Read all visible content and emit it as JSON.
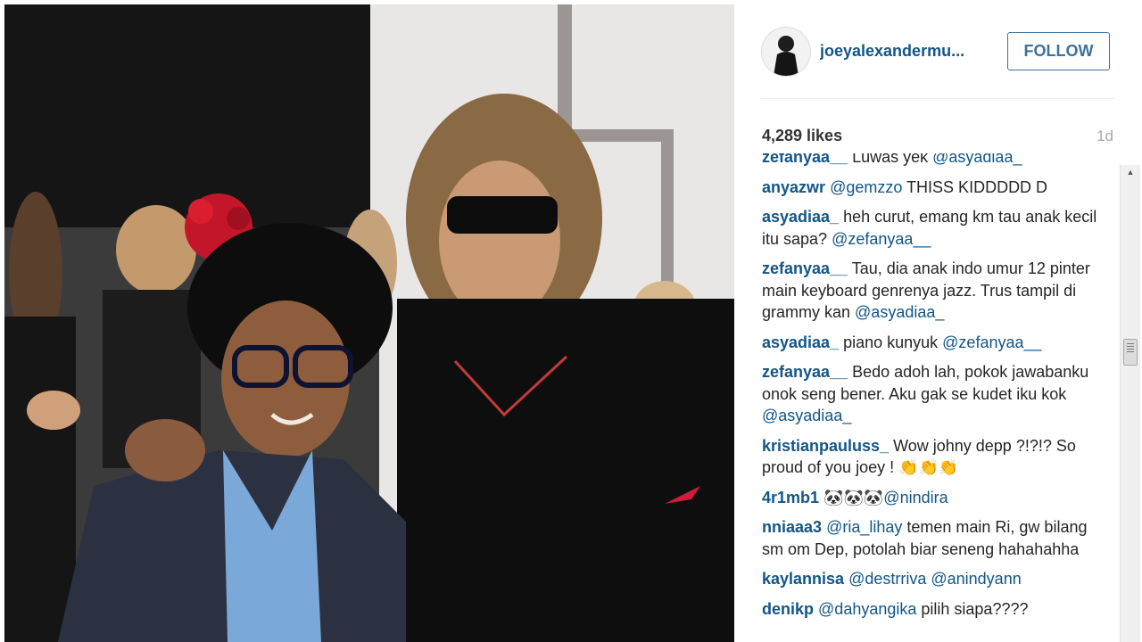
{
  "post": {
    "photo_alt": "photo",
    "username": "joeyalexandermu...",
    "follow_label": "FOLLOW",
    "likes": "4,289 likes",
    "time_ago": "1d"
  },
  "comments": [
    {
      "user": "zefanyaa__",
      "text": " Luwas yek ",
      "mention": "@asyadiaa_",
      "tail": ""
    },
    {
      "user": "anyazwr",
      "text": " ",
      "mention": "@gemzzo",
      "tail": " THISS KIDDDDD D"
    },
    {
      "user": "asyadiaa_",
      "text": " heh curut, emang km tau anak kecil itu sapa? ",
      "mention": "@zefanyaa__",
      "tail": ""
    },
    {
      "user": "zefanyaa__",
      "text": " Tau, dia anak indo umur 12 pinter main keyboard genrenya jazz. Trus tampil di grammy kan ",
      "mention": "@asyadiaa_",
      "tail": ""
    },
    {
      "user": "asyadiaa_",
      "text": " piano kunyuk ",
      "mention": "@zefanyaa__",
      "tail": ""
    },
    {
      "user": "zefanyaa__",
      "text": " Bedo adoh lah, pokok jawabanku onok seng bener. Aku gak se kudet iku kok ",
      "mention": "@asyadiaa_",
      "tail": ""
    },
    {
      "user": "kristianpauluss_",
      "text": " Wow johny depp ?!?!? So proud of you joey ! 👏👏👏",
      "mention": "",
      "tail": ""
    },
    {
      "user": "4r1mb1",
      "text": " 🐼🐼🐼",
      "mention": "@nindira",
      "tail": ""
    },
    {
      "user": "nniaaa3",
      "text": " ",
      "mention": "@ria_lihay",
      "tail": " temen main Ri, gw bilang sm om Dep, potolah biar seneng hahahahha"
    },
    {
      "user": "kaylannisa",
      "text": " ",
      "mention": "@destrriva @anindyann",
      "tail": ""
    },
    {
      "user": "denikp",
      "text": " ",
      "mention": "@dahyangika",
      "tail": " pilih siapa????"
    }
  ],
  "colors": {
    "link": "#125688",
    "follow_border": "#3f729b",
    "text": "#262626",
    "muted": "#a5a7aa"
  }
}
